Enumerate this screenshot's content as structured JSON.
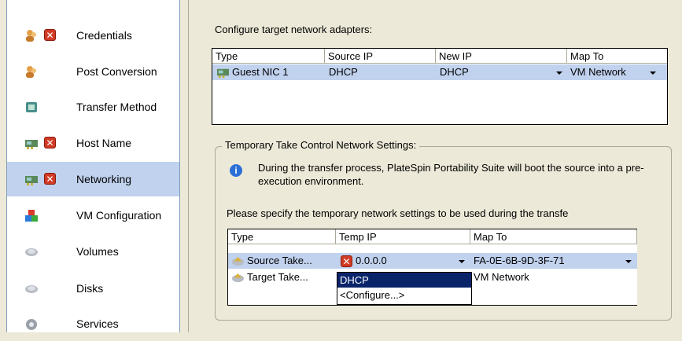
{
  "sidebar": {
    "items": [
      {
        "label": "Credentials",
        "icons": [
          "user-icon",
          "error-icon"
        ],
        "selected": false
      },
      {
        "label": "Post Conversion",
        "icons": [
          "user-icon"
        ],
        "selected": false
      },
      {
        "label": "Transfer Method",
        "icons": [
          "transfer-icon"
        ],
        "selected": false
      },
      {
        "label": "Host Name",
        "icons": [
          "network-card-icon",
          "error-icon"
        ],
        "selected": false
      },
      {
        "label": "Networking",
        "icons": [
          "network-card-icon",
          "error-icon"
        ],
        "selected": true
      },
      {
        "label": "VM Configuration",
        "icons": [
          "vm-config-icon"
        ],
        "selected": false
      },
      {
        "label": "Volumes",
        "icons": [
          "volume-icon"
        ],
        "selected": false
      },
      {
        "label": "Disks",
        "icons": [
          "disk-icon"
        ],
        "selected": false
      },
      {
        "label": "Services",
        "icons": [
          "services-gear-icon"
        ],
        "selected": false
      }
    ]
  },
  "main": {
    "configure_label": "Configure target network adapters:",
    "adapters_table": {
      "headers": [
        "Type",
        "Source IP",
        "New IP",
        "Map To"
      ],
      "rows": [
        {
          "type": "Guest NIC 1",
          "source_ip": "DHCP",
          "new_ip": "DHCP",
          "map_to": "VM Network"
        }
      ]
    },
    "take_control": {
      "group_title": "Temporary Take Control Network Settings:",
      "info_text": "During the transfer process, PlateSpin Portability Suite will boot the source into a pre-execution environment.",
      "specify_text": "Please specify the temporary network settings to be used during the transfe",
      "table": {
        "headers": [
          "Type",
          "Temp IP",
          "Map To"
        ],
        "rows": [
          {
            "type": "Source Take...",
            "temp_ip": "0.0.0.0",
            "map_to": "FA-0E-6B-9D-3F-71"
          },
          {
            "type": "Target Take...",
            "temp_ip": "",
            "map_to": "VM Network"
          }
        ]
      },
      "dropdown_options": [
        "DHCP",
        "<Configure...>"
      ]
    }
  },
  "colors": {
    "selection": "#c1d2ee",
    "dropdown_highlight": "#0a246a",
    "error": "#d13b25",
    "info": "#2b6fd6"
  }
}
